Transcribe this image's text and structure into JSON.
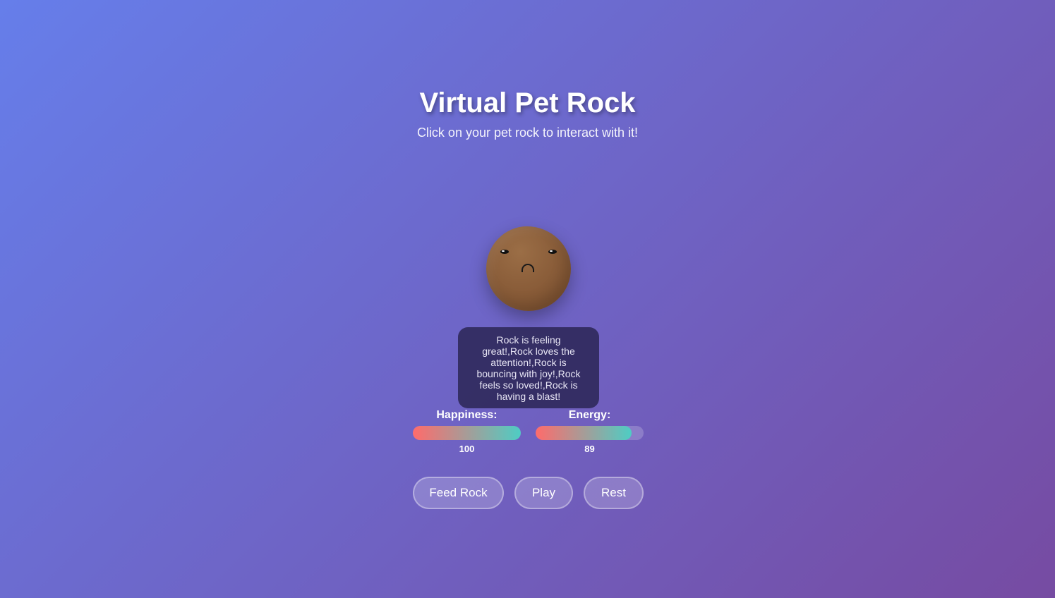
{
  "header": {
    "title": "Virtual Pet Rock",
    "subtitle": "Click on your pet rock to interact with it!"
  },
  "rock": {
    "mood": "sad",
    "message": "Rock is feeling great!,Rock loves the attention!,Rock is bouncing with joy!,Rock feels so loved!,Rock is having a blast!"
  },
  "stats": {
    "happiness": {
      "label": "Happiness:",
      "value": "100",
      "fill_percent": 100
    },
    "energy": {
      "label": "Energy:",
      "value": "89",
      "fill_percent": 89
    }
  },
  "actions": {
    "feed_label": "Feed Rock",
    "play_label": "Play",
    "rest_label": "Rest"
  },
  "colors": {
    "background_start": "#667eea",
    "background_end": "#764ba2",
    "rock": "#8b5e3a",
    "bar_start": "#ff6b6b",
    "bar_end": "#4ecdc4"
  }
}
